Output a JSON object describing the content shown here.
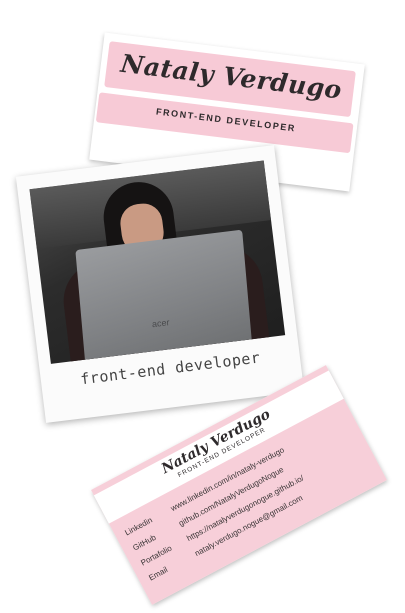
{
  "top_card": {
    "name": "Nataly Verdugo",
    "role": "FRONT-END DEVELOPER"
  },
  "polaroid": {
    "laptop_logo": "acer",
    "caption": "front-end developer"
  },
  "contact_card": {
    "name": "Nataly Verdugo",
    "role": "FRONT-END DEVELOPER",
    "rows": [
      {
        "label": "Linkedin",
        "value": "www.linkedin.com/in/nataly-verdugo"
      },
      {
        "label": "GitHub",
        "value": "github.com/NatalyVerdugoNogue"
      },
      {
        "label": "Portafolio",
        "value": "https://natalyverdugonogue.github.io/"
      },
      {
        "label": "Email",
        "value": "nataly.verdugo.nogue@gmail.com"
      }
    ]
  },
  "colors": {
    "pink": "#f7cad6",
    "ink": "#2e2a2c"
  }
}
